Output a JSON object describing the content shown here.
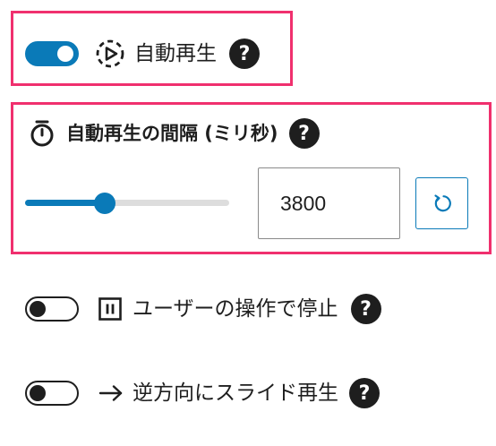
{
  "settings": {
    "autoplay": {
      "label": "自動再生",
      "enabled": true,
      "icon": "autoplay-icon",
      "help_text": "?"
    },
    "interval": {
      "label": "自動再生の間隔 (ミリ秒)",
      "icon": "stopwatch-icon",
      "help_text": "?",
      "value": "3800",
      "slider_fraction": 0.39,
      "reset_icon": "reset-icon"
    },
    "pause_on_interaction": {
      "label": "ユーザーの操作で停止",
      "enabled": false,
      "icon": "pause-icon",
      "help_text": "?"
    },
    "reverse": {
      "label": "逆方向にスライド再生",
      "enabled": false,
      "icon": "arrow-right-icon",
      "help_text": "?"
    }
  },
  "colors": {
    "accent": "#0a7ab8",
    "highlight": "#f0306e",
    "text": "#1e1e1e"
  }
}
